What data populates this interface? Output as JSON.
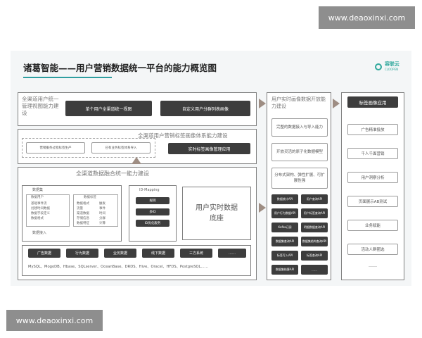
{
  "watermark_top": "www.deaoxinxi.com",
  "watermark_bottom": "www.deaoxinxi.com",
  "title": "诸葛智能——用户营销数据统一平台的能力概览图",
  "logo": {
    "cn": "容联云",
    "en": "CLOOPEN"
  },
  "omni_user": {
    "label": "全渠道用户统一管理视图能力建设",
    "items": [
      "单个用户全渠道统一视图",
      "自定义用户分群列表画像"
    ]
  },
  "omni_tag": {
    "label": "全渠道用户营销标签画像体系能力建设",
    "items": [
      "营销服务过程标签生产",
      "已有业务标签体系导入"
    ],
    "app": "实时标签画像管理应用"
  },
  "data_fusion": {
    "label": "全渠道数据融合统一能力建设",
    "dataset_label": "数据集",
    "user_data_label": "数据用户",
    "user_data_items": [
      "基础事件流",
      "创建时间数据",
      "数据字段定义",
      "数据格式"
    ],
    "tag_data_label": "数据标签",
    "tag_data_items": [
      "数据格式",
      "流量",
      "渠道数据",
      "存储信息",
      "数据特征"
    ],
    "tag_data_items2": [
      "触发",
      "事件",
      "时间",
      "分群",
      "计算"
    ],
    "access_label": "数据接入",
    "idmapping_label": "ID-Mapping",
    "idmapping_items": [
      "规则",
      "多ID",
      "ID优化服务"
    ],
    "realtime_label": "用户实时数据底座",
    "sources": [
      "广告数据",
      "行为数据",
      "业务数据",
      "线下数据",
      "三方系统",
      "……"
    ],
    "db_list": "MySQL、MogoDB、Hbase、SQLserver、OceanBase、DRDS、Hive、Oracel、HFDS、PostgreSQL……"
  },
  "open": {
    "label": "用户实时画像数据开放能力建设",
    "caps": [
      "完整的数据接入与导入能力",
      "开放灵活的原子化数据模型",
      "分布式架构、弹性扩展、可扩展性强"
    ],
    "apis": [
      "数据统计API",
      "用户查询API",
      "用户行为数据API",
      "用户标签查询API",
      "Kafka订阅",
      "明细数据查询API",
      "数据集查询API",
      "数据集结构查询API",
      "标签写入API",
      "标签查询API",
      "数据集结算API",
      "……"
    ]
  },
  "apps": {
    "label": "标签画像应用",
    "items": [
      "广告精准投放",
      "千人千面营销",
      "用户洞察分析",
      "页面展示AB测试",
      "业务赋能",
      "活动人群圈选",
      "……"
    ]
  }
}
